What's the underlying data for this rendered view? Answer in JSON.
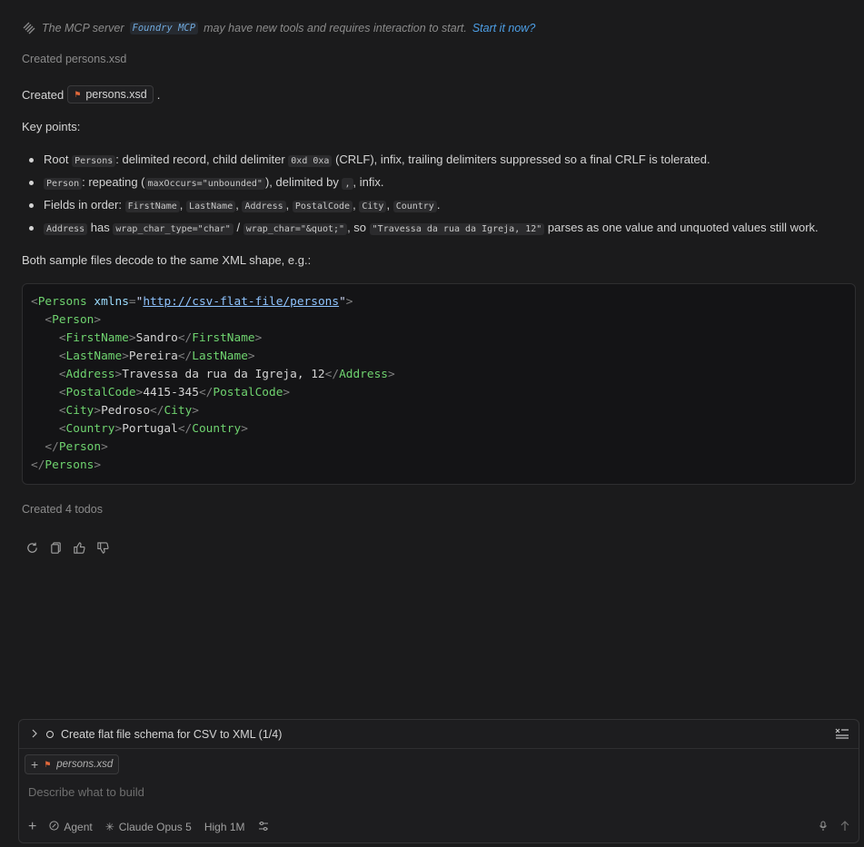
{
  "notice": {
    "prefix": "The MCP server",
    "server": "Foundry MCP",
    "suffix": "may have new tools and requires interaction to start.",
    "link": "Start it now?"
  },
  "created_file_status": {
    "label": "Created",
    "file": "persons.xsd"
  },
  "created_line": {
    "label": "Created",
    "file": "persons.xsd",
    "period": "."
  },
  "key_points_heading": "Key points:",
  "points": {
    "p1": {
      "t1": "Root",
      "c1": "Persons",
      "t2": ": delimited record, child delimiter",
      "c2": "0xd 0xa",
      "t3": "(CRLF), infix, trailing delimiters suppressed so a final CRLF is tolerated."
    },
    "p2": {
      "c1": "Person",
      "t1": ": repeating (",
      "c2": "maxOccurs=\"unbounded\"",
      "t2": "), delimited by",
      "c3": ",",
      "t3": ", infix."
    },
    "p3": {
      "t1": "Fields in order:",
      "c1": "FirstName",
      "c2": "LastName",
      "c3": "Address",
      "c4": "PostalCode",
      "c5": "City",
      "c6": "Country",
      "sep": ",",
      "end": "."
    },
    "p4": {
      "c1": "Address",
      "t1": "has",
      "c2": "wrap_char_type=\"char\"",
      "t2": "/",
      "c3": "wrap_char=\"&quot;\"",
      "t3": ", so",
      "c4": "\"Travessa da rua da Igreja, 12\"",
      "t4": "parses as one value and unquoted values still work."
    }
  },
  "both_text": "Both sample files decode to the same XML shape, e.g.:",
  "xml": {
    "root": "Persons",
    "attr": "xmlns",
    "ns": "http://csv-flat-file/persons",
    "person": "Person",
    "fields": [
      {
        "tag": "FirstName",
        "value": "Sandro"
      },
      {
        "tag": "LastName",
        "value": "Pereira"
      },
      {
        "tag": "Address",
        "value": "Travessa da rua da Igreja, 12"
      },
      {
        "tag": "PostalCode",
        "value": "4415-345"
      },
      {
        "tag": "City",
        "value": "Pedroso"
      },
      {
        "tag": "Country",
        "value": "Portugal"
      }
    ]
  },
  "todos_status": "Created 4 todos",
  "composer": {
    "todo_title": "Create flat file schema for CSV to XML (1/4)",
    "attachment": "persons.xsd",
    "placeholder": "Describe what to build",
    "mode": "Agent",
    "model": "Claude Opus 5",
    "effort": "High 1M"
  },
  "colors": {
    "background": "#1b1b1c",
    "tag": "#6fd36f",
    "link": "#4d9fe6",
    "xml_file": "#e0683b"
  },
  "icons": [
    "mcp-icon",
    "xml-file-icon",
    "retry-icon",
    "copy-icon",
    "thumbs-up-icon",
    "thumbs-down-icon",
    "chevron-right-icon",
    "todo-list-icon",
    "plus-icon",
    "agent-icon",
    "model-icon",
    "settings-sliders-icon",
    "mic-icon",
    "send-arrow-icon"
  ]
}
